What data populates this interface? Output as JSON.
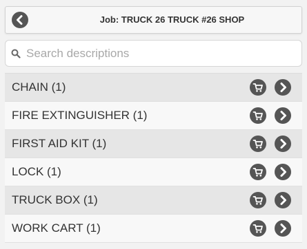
{
  "header": {
    "title": "Job: TRUCK 26 TRUCK #26 SHOP",
    "back_icon": "chevron-left-icon"
  },
  "search": {
    "placeholder": "Search descriptions",
    "value": "",
    "icon": "search-icon"
  },
  "items": [
    {
      "label": "CHAIN (1)"
    },
    {
      "label": "FIRE EXTINGUISHER (1)"
    },
    {
      "label": "FIRST AID KIT (1)"
    },
    {
      "label": "LOCK (1)"
    },
    {
      "label": "TRUCK BOX (1)"
    },
    {
      "label": "WORK CART (1)"
    }
  ],
  "row_icons": [
    "cart-icon",
    "chevron-right-icon"
  ],
  "colors": {
    "icon_bg": "#555555",
    "row_odd": "#e6e6e6",
    "row_even": "#f8f8f8",
    "page_bg": "#f2f2f2"
  }
}
